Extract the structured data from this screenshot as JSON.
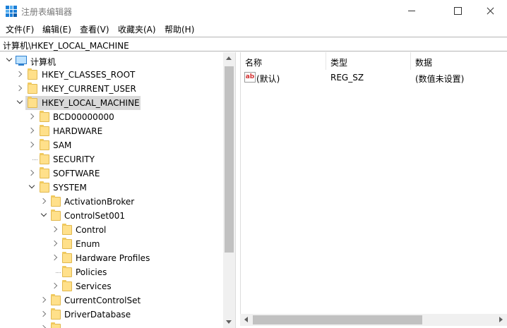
{
  "window": {
    "title": "注册表编辑器"
  },
  "menu": [
    "文件(F)",
    "编辑(E)",
    "查看(V)",
    "收藏夹(A)",
    "帮助(H)"
  ],
  "address": "计算机\\HKEY_LOCAL_MACHINE",
  "tree": {
    "root": "计算机",
    "nodes": [
      {
        "label": "HKEY_CLASSES_ROOT",
        "state": "collapsed"
      },
      {
        "label": "HKEY_CURRENT_USER",
        "state": "collapsed"
      },
      {
        "label": "HKEY_LOCAL_MACHINE",
        "state": "expanded",
        "selected": true
      },
      {
        "label": "BCD00000000",
        "state": "collapsed"
      },
      {
        "label": "HARDWARE",
        "state": "collapsed"
      },
      {
        "label": "SAM",
        "state": "collapsed"
      },
      {
        "label": "SECURITY",
        "state": "leaf"
      },
      {
        "label": "SOFTWARE",
        "state": "collapsed"
      },
      {
        "label": "SYSTEM",
        "state": "expanded"
      },
      {
        "label": "ActivationBroker",
        "state": "collapsed"
      },
      {
        "label": "ControlSet001",
        "state": "expanded"
      },
      {
        "label": "Control",
        "state": "collapsed"
      },
      {
        "label": "Enum",
        "state": "collapsed"
      },
      {
        "label": "Hardware Profiles",
        "state": "collapsed"
      },
      {
        "label": "Policies",
        "state": "leaf"
      },
      {
        "label": "Services",
        "state": "collapsed"
      },
      {
        "label": "CurrentControlSet",
        "state": "collapsed"
      },
      {
        "label": "DriverDatabase",
        "state": "collapsed"
      }
    ]
  },
  "list": {
    "headers": {
      "name": "名称",
      "type": "类型",
      "data": "数据"
    },
    "rows": [
      {
        "icon": "string-value-icon",
        "badge": "ab",
        "name": "(默认)",
        "type": "REG_SZ",
        "data": "(数值未设置)"
      }
    ]
  },
  "colors": {
    "folder": "#ffe08a",
    "selection": "#d9d9d9",
    "accent": "#1b7fd8"
  }
}
